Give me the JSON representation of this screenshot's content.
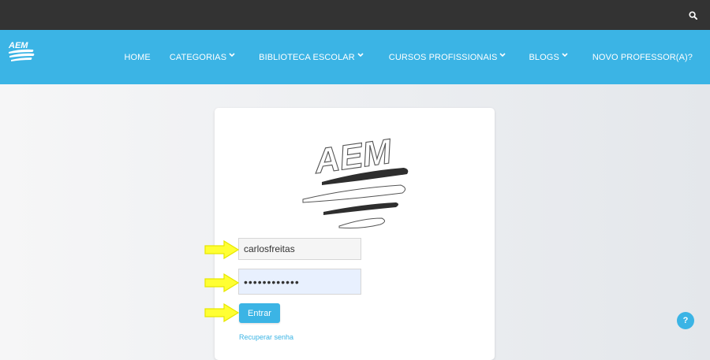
{
  "header": {
    "brand_text": "AEM",
    "search_icon": "search-icon"
  },
  "nav": {
    "items": [
      {
        "label": "HOME",
        "has_dropdown": false
      },
      {
        "label": "CATEGORIAS",
        "has_dropdown": true
      },
      {
        "label": "BIBLIOTECA ESCOLAR",
        "has_dropdown": true
      },
      {
        "label": "CURSOS PROFISSIONAIS",
        "has_dropdown": true
      },
      {
        "label": "BLOGS",
        "has_dropdown": true
      },
      {
        "label": "NOVO PROFESSOR(A)?",
        "has_dropdown": false
      }
    ]
  },
  "login": {
    "logo_text": "AEM",
    "username_value": "carlosfreitas",
    "password_value": "••••••••••••",
    "submit_label": "Entrar",
    "forgot_label": "Recuperar senha"
  },
  "help": {
    "label": "?"
  },
  "colors": {
    "topbar": "#333333",
    "accent": "#3bb4e5",
    "annotation_arrow": "#ffff33"
  }
}
